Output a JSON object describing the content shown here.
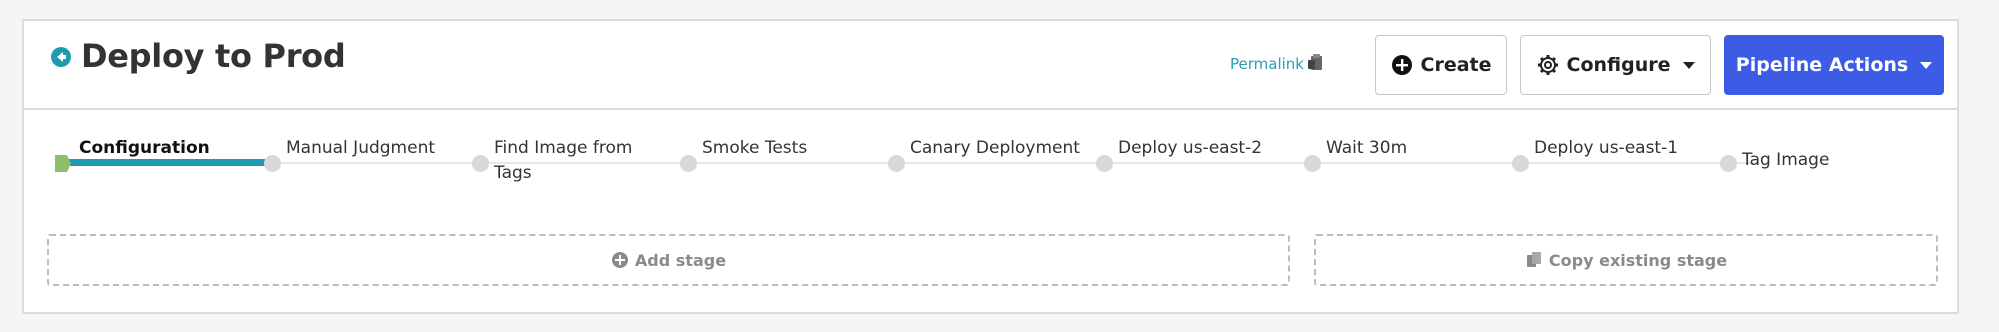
{
  "header": {
    "title": "Deploy to Prod",
    "permalink": "Permalink",
    "create_label": "Create",
    "configure_label": "Configure",
    "actions_label": "Pipeline Actions"
  },
  "icons": {
    "back": "arrow-left-circle-icon",
    "clipboard": "clipboard-icon",
    "create": "plus-circle-icon",
    "configure": "gear-icon",
    "add_stage": "plus-circle-icon",
    "copy_stage": "copy-icon"
  },
  "colors": {
    "accent": "#1e9bb0",
    "primary_button": "#3d5ce6",
    "first_stage_marker": "#8fbf6a"
  },
  "stages": [
    {
      "label": "Configuration",
      "active": true
    },
    {
      "label": "Manual Judgment",
      "active": false
    },
    {
      "label": "Find Image from Tags",
      "active": false
    },
    {
      "label": "Smoke Tests",
      "active": false
    },
    {
      "label": "Canary Deployment",
      "active": false
    },
    {
      "label": "Deploy us-east-2",
      "active": false
    },
    {
      "label": "Wait 30m",
      "active": false
    },
    {
      "label": "Deploy us-east-1",
      "active": false
    },
    {
      "label": "Tag Image",
      "active": false
    }
  ],
  "actions": {
    "add_stage": "Add stage",
    "copy_stage": "Copy existing stage"
  }
}
